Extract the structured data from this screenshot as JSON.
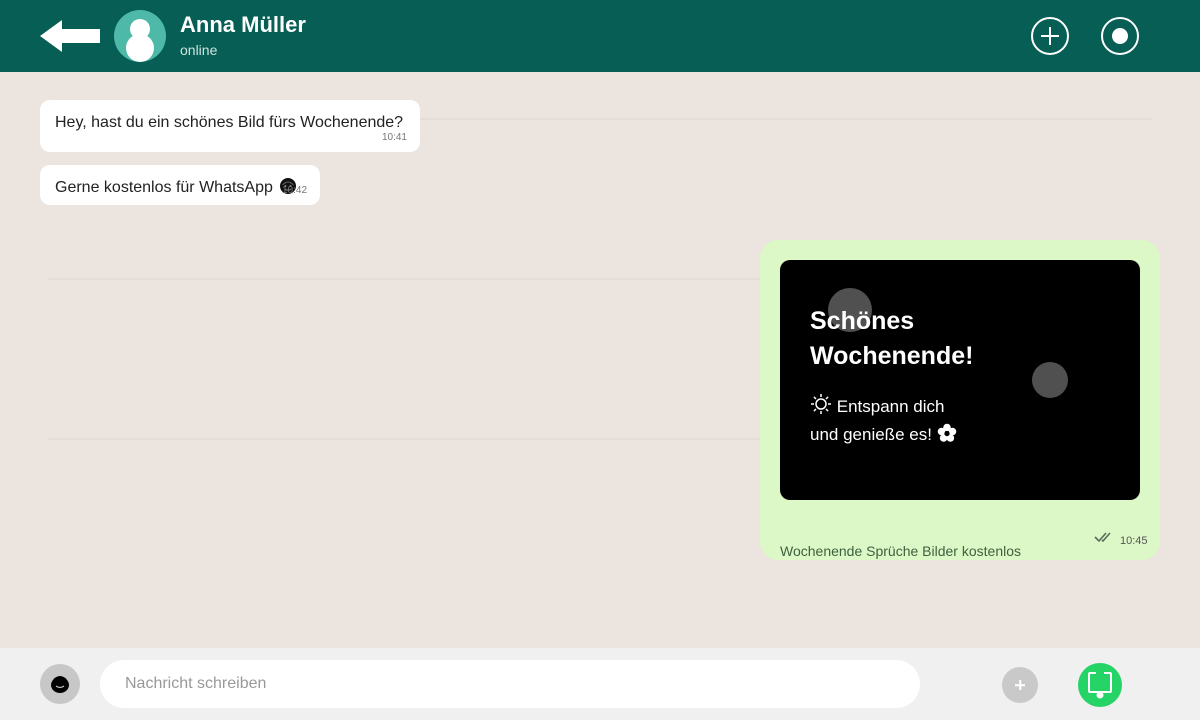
{
  "colors": {
    "header_bg": "#075e54",
    "chat_bg": "#ece5df",
    "incoming_bubble": "#ffffff",
    "outgoing_bubble": "#dcf8c6",
    "send_button": "#25d366"
  },
  "header": {
    "back_icon": "arrow-left-icon",
    "contact_name": "Anna Müller",
    "status": "online",
    "actions": [
      "add-icon",
      "record-icon"
    ]
  },
  "messages": [
    {
      "direction": "incoming",
      "text": "Hey, hast du ein schönes Bild fürs Wochenende?",
      "time": "10:41"
    },
    {
      "direction": "incoming",
      "text": "Gerne kostenlos für WhatsApp",
      "emoji": "smiling-face-icon",
      "time": "10:42"
    },
    {
      "direction": "outgoing",
      "image": {
        "title": "Schönes Wochenende!",
        "line1": "Entspann dich",
        "line2": "und genieße es!",
        "icons": [
          "sun-icon",
          "flower-icon"
        ]
      },
      "caption": "Wochenende Sprüche Bilder kostenlos",
      "time": "10:45",
      "status_icon": "double-check-icon"
    }
  ],
  "composer": {
    "placeholder": "Nachricht schreiben",
    "value": "",
    "icons": [
      "emoji-icon",
      "attach-icon",
      "mic-icon"
    ]
  }
}
